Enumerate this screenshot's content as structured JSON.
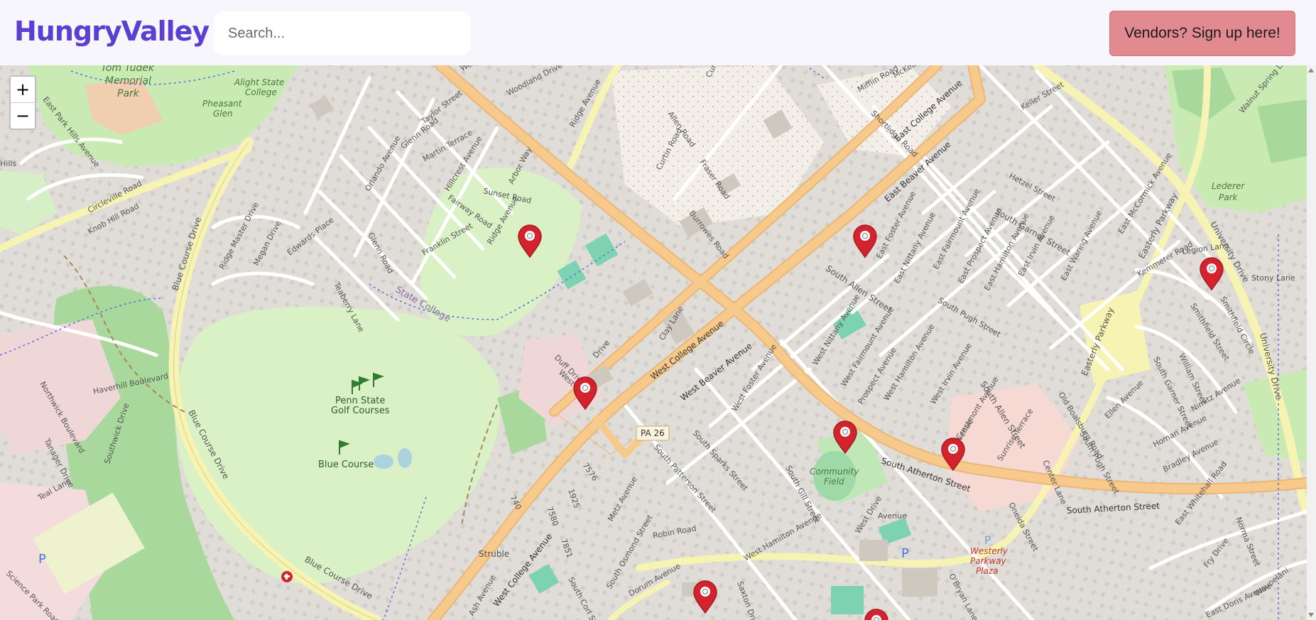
{
  "header": {
    "logo_text": "HungryValley",
    "search_placeholder": "Search...",
    "vendor_button_label": "Vendors? Sign up here!"
  },
  "map": {
    "zoom_in_label": "+",
    "zoom_out_label": "−",
    "labels": {
      "tom_tudek": "Tom Tudek",
      "memorial_park": "Memorial",
      "park": "Park",
      "alight": "Alight State",
      "college": "College",
      "pheasant": "Pheasant",
      "glen": "Glen",
      "hills": "Hills",
      "circleville": "Circleville Road",
      "knob_hill": "Knob Hill Road",
      "east_park_hills": "East Park Hills Avenue",
      "blue_course_drive_1": "Blue Course Drive",
      "blue_course_drive_2": "Blue Course Drive",
      "blue_course_drive_3": "Blue Course Drive",
      "ridge_master": "Ridge Master Drive",
      "megan": "Megan Drive",
      "edwards": "Edwards Place",
      "teaberry": "Teaberry Lane",
      "glenn_road": "Glenn Road",
      "glenn_road_2": "Glenn Road",
      "orlando": "Orlando Avenue",
      "martin": "Martin Terrace",
      "hillcrest": "Hillcrest Avenue",
      "fairway": "Fairway Road",
      "sunset": "Sunset Road",
      "franklin": "Franklin Street",
      "ridge_ave": "Ridge Avenue",
      "ridge_ave_2": "Ridge Avenue",
      "arbor": "Arbor Way",
      "taylor": "Taylor Street",
      "woodland": "Woodland Drive",
      "west_mitchell": "West Mitchell",
      "state_college": "State College",
      "penn_state": "Penn State",
      "golf_courses": "Golf Courses",
      "blue_course": "Blue Course",
      "haverhill": "Haverhill Boulevard",
      "northwick": "Northwick Boulevard",
      "southwick": "Southwick Drive",
      "tanager": "Tanager Drive",
      "teal": "Teal Lane",
      "science_park": "Science Park Road",
      "west_college_1": "West College Avenue",
      "west_college_2": "West College Avenue",
      "west_beaver": "West Beaver Avenue",
      "east_college": "East College Avenue",
      "east_beaver": "East Beaver Avenue",
      "pa26": "PA 26",
      "duff": "Duff Drive",
      "south_sparks": "South Sparks Street",
      "south_patterson": "South Patterson Street",
      "south_allen_1": "South Allen Street",
      "south_allen_2": "South Allen Street",
      "south_atherton_1": "South Atherton Street",
      "south_atherton_2": "South Atherton Street",
      "south_pugh": "South Pugh Street",
      "south_pugh_2": "South Pugh Street",
      "south_garner": "South Garner Street",
      "south_garner_2": "South Garner Street",
      "east_foster": "East Foster Avenue",
      "east_nittany": "East Nittany Avenue",
      "east_fairmount": "East Fairmount Avenue",
      "east_prospect": "East Prospect Avenue",
      "east_hamilton": "East Hamilton Avenue",
      "east_irvin": "East Irvin Avenue",
      "east_waring": "East Waring Avenue",
      "east_mccormick": "East McCormick Avenue",
      "west_nittany": "West Nittany Avenue",
      "west_fairmount": "West Fairmount Avenue",
      "west_foster": "West Foster Avenue",
      "west_hamilton_1": "West Hamilton Avenue",
      "west_hamilton_2": "West Hamilton Avenue",
      "west_irvin": "West Irvin Avenue",
      "prospect": "Prospect Avenue",
      "crestmont": "Crestmont Avenue",
      "sunrise": "Sunrise Terrace",
      "old_boalsburg": "Old Boalsburg Road",
      "ellen": "Ellen Avenue",
      "homan": "Homan Avenue",
      "bradley": "Bradley Avenue",
      "nimitz": "Nimitz Avenue",
      "william": "William Street",
      "kemmerer": "Kemmerer Road",
      "legion": "Legion Lane",
      "stony": "Stony Lane",
      "smithfield_st": "Smithfield Street",
      "smithfield_cir": "Smithfield Circle",
      "easterly_1": "Easterly Parkway",
      "easterly_2": "Easterly Parkway",
      "university_1": "University Drive",
      "university_2": "University Drive",
      "lederer": "Lederer",
      "lederer_park": "Park",
      "walnut": "Walnut Spring Lane",
      "hetzel": "Hetzel Street",
      "keller": "Keller Street",
      "mifflin": "Mifflin Road",
      "mckean": "McKean",
      "shortlidge": "Shortlidge Road",
      "curtin": "Curtin Road",
      "allen_road": "Allen Road",
      "fraser": "Fraser Road",
      "burrowes": "Burrowes Road",
      "clay": "Clay Lane",
      "curtin_top": "Curtin",
      "community": "Community",
      "field": "Field",
      "westerly": "Westerly",
      "parkway": "Parkway",
      "plaza": "Plaza",
      "oneida": "Oneida Street",
      "center": "Center Lane",
      "saxton": "Saxton Drive",
      "dorum": "Dorum Avenue",
      "robin": "Robin Road",
      "metz": "Metz Avenue",
      "south_osmond": "South Osmond Street",
      "south_gill": "South Gill Street",
      "south_corl": "South Corl Street",
      "obryan": "O'Bryan Lane",
      "east_whitehall": "East Whitehall Road",
      "fry": "Fry Drive",
      "norma": "Norma Street",
      "east_doris": "East Doris Avenue",
      "waupelani": "Waupelani",
      "struble": "Struble",
      "ash": "Ash Avenue",
      "avenue": "Avenue",
      "n7576": "7576",
      "n1925": "1925",
      "n7580": "7580",
      "n7851": "7851",
      "n740": "740",
      "p1": "P",
      "p2": "P",
      "p3": "P",
      "west_drive": "West Drive",
      "west_short": "West",
      "drive_short": "Drive",
      "on_avenue": "on Avenue"
    },
    "markers": [
      {
        "name": "vendor-marker-1"
      },
      {
        "name": "vendor-marker-2"
      },
      {
        "name": "vendor-marker-3"
      },
      {
        "name": "vendor-marker-4"
      },
      {
        "name": "vendor-marker-5"
      },
      {
        "name": "vendor-marker-6"
      },
      {
        "name": "vendor-marker-7"
      },
      {
        "name": "vendor-marker-8"
      }
    ]
  },
  "colors": {
    "brand": "#5a3fd0",
    "vendor_button": "#e18a90",
    "marker": "#d3232e",
    "major_road": "#f7c98a",
    "secondary_road": "#f6f3b3",
    "golf": "#d9f1c4",
    "park": "#c9ebb3",
    "wood": "#a9d89c"
  }
}
